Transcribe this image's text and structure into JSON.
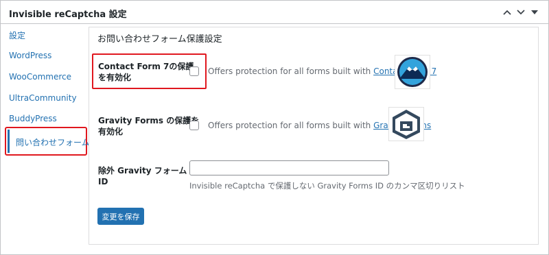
{
  "header": {
    "title": "Invisible reCaptcha 設定",
    "collapse_up_icon": "chevron-up-icon",
    "collapse_down_icon": "chevron-down-icon",
    "toggle_icon": "caret-down-icon"
  },
  "sidebar": {
    "items": [
      {
        "label": "設定"
      },
      {
        "label": "WordPress"
      },
      {
        "label": "WooCommerce"
      },
      {
        "label": "UltraCommunity"
      },
      {
        "label": "BuddyPress"
      },
      {
        "label": "問い合わせフォーム",
        "active": true
      }
    ]
  },
  "panel": {
    "title": "お問い合わせフォーム保護設定",
    "rows": [
      {
        "label_line1": "Contact Form 7の保護",
        "label_line2": "を有効化",
        "checked": false,
        "desc_prefix": "Offers protection for all forms built with ",
        "desc_link": "Contact Form 7",
        "logo": "contact-form-7-logo"
      },
      {
        "label_line1": "Gravity Forms の保護を",
        "label_line2": "有効化",
        "checked": false,
        "desc_prefix": "Offers protection for all forms built with ",
        "desc_link": "Gravity Forms",
        "logo": "gravity-forms-logo"
      },
      {
        "label_line1": "除外 Gravity フォーム",
        "label_line2": "ID",
        "input_value": "",
        "hint": "Invisible reCaptcha で保護しない Gravity Forms ID のカンマ区切りリスト"
      }
    ],
    "save_label": "変更を保存"
  },
  "colors": {
    "accent": "#2271b1",
    "highlight": "#e0171e"
  }
}
